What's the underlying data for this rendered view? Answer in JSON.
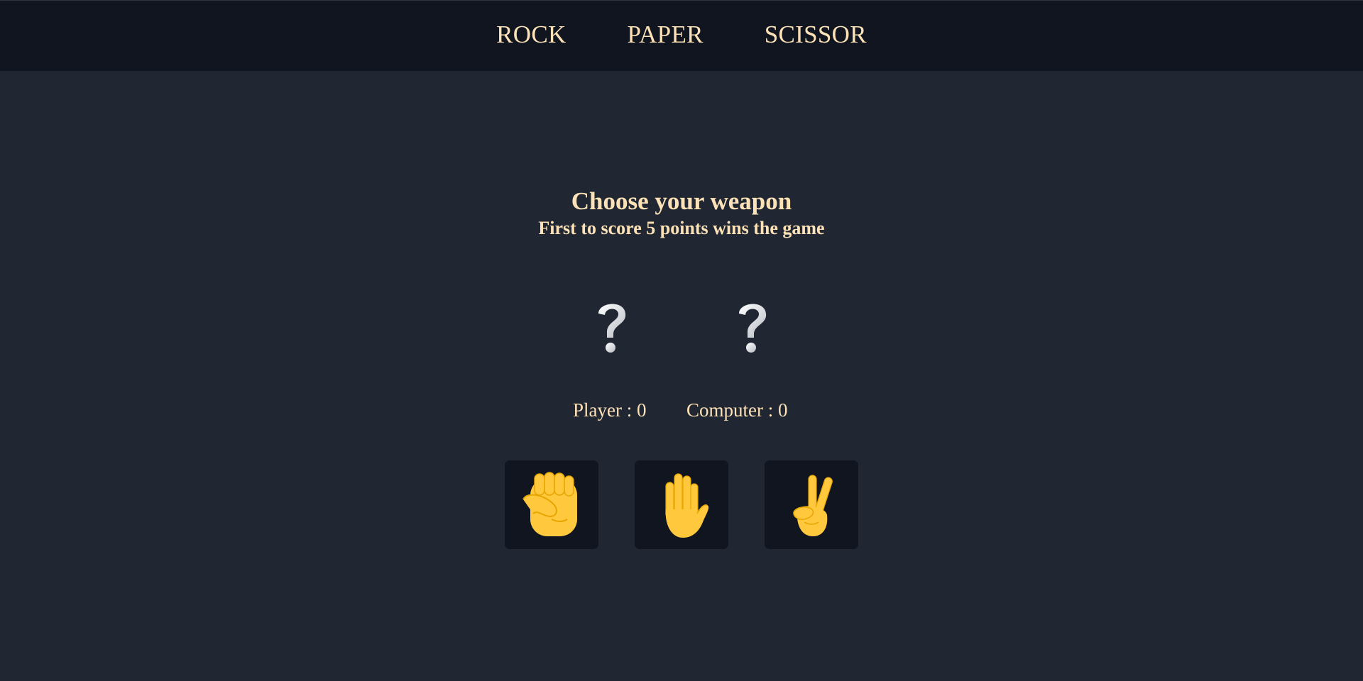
{
  "nav": {
    "items": [
      {
        "label": "ROCK"
      },
      {
        "label": "PAPER"
      },
      {
        "label": "SCISSOR"
      }
    ]
  },
  "main": {
    "title": "Choose your weapon",
    "subtitle": "First to score 5 points wins the game"
  },
  "choices": {
    "player": {
      "icon": "question-mark-icon"
    },
    "computer": {
      "icon": "question-mark-icon"
    }
  },
  "scores": {
    "player_label": "Player : 0",
    "computer_label": "Computer : 0"
  },
  "weapons": [
    {
      "icon": "raised-fist-icon"
    },
    {
      "icon": "raised-hand-icon"
    },
    {
      "icon": "victory-hand-icon"
    }
  ],
  "colors": {
    "background": "#202733",
    "header": "#10151f",
    "text": "#fde2b8",
    "emoji_yellow": "#ffc83d"
  }
}
